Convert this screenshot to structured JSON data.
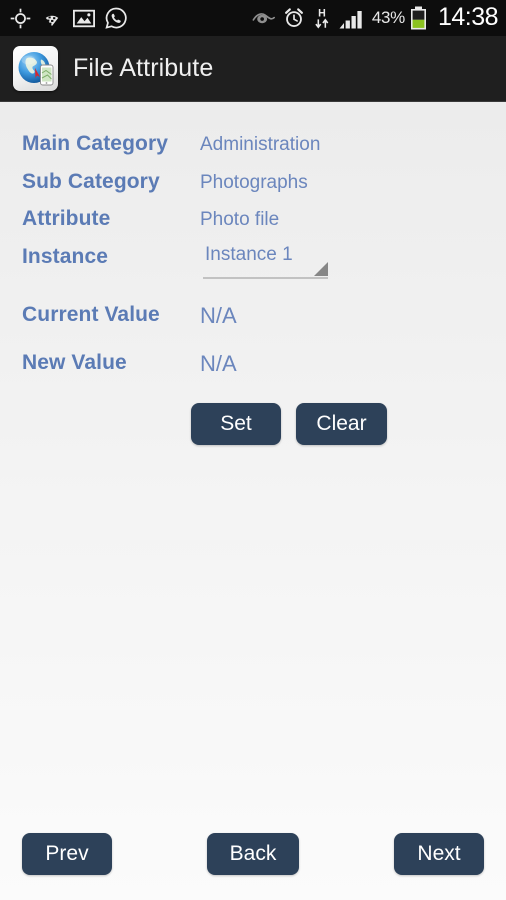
{
  "status_bar": {
    "left_icons": [
      {
        "name": "gps-location-icon",
        "label": "GPS"
      },
      {
        "name": "wifi-icon",
        "label": "Wi-Fi"
      },
      {
        "name": "image-gallery-icon",
        "label": "Screenshot captured"
      },
      {
        "name": "whatsapp-icon",
        "label": "WhatsApp"
      }
    ],
    "right_icons": [
      {
        "name": "smart-stay-eye-icon",
        "label": "Smart stay"
      },
      {
        "name": "alarm-clock-icon",
        "label": "Alarm set"
      },
      {
        "name": "hsdpa-data-icon",
        "label": "H"
      },
      {
        "name": "signal-bars-icon",
        "label": "Signal"
      },
      {
        "name": "battery-icon",
        "label": "Battery"
      }
    ],
    "battery_percent": "43%",
    "clock": "14:38"
  },
  "title_bar": {
    "app_icon_name": "globe-phone-app-icon",
    "title": "File Attribute"
  },
  "form": {
    "rows": [
      {
        "label": "Main Category",
        "value": "Administration"
      },
      {
        "label": "Sub Category",
        "value": "Photographs"
      },
      {
        "label": "Attribute",
        "value": "Photo file"
      },
      {
        "label": "Instance",
        "value": "Instance 1"
      },
      {
        "label": "Current Value",
        "value": "N/A"
      },
      {
        "label": "New Value",
        "value": "N/A"
      }
    ],
    "instance_spinner": {
      "selected": "Instance 1",
      "arrow_icon": "dropdown-triangle-icon"
    }
  },
  "action_buttons": {
    "set": "Set",
    "clear": "Clear"
  },
  "navigation_buttons": {
    "prev": "Prev",
    "back": "Back",
    "next": "Next"
  },
  "colors": {
    "status_bar_bg": "#0d0d0d",
    "title_bar_bg": "#1f1f1f",
    "label_blue": "#5b7bb5",
    "value_blue": "#6b86bd",
    "button_navy": "#2d4159",
    "battery_green": "#8bc220",
    "content_bg_top": "#ececec",
    "content_bg_bottom": "#fbfbfb"
  }
}
